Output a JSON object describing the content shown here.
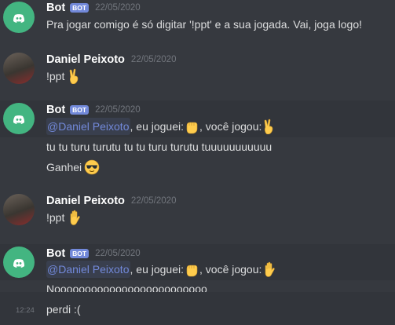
{
  "messages": {
    "m1": {
      "author": "Bot",
      "badge": "BOT",
      "timestamp": "22/05/2020",
      "text": "Pra jogar comigo é só digitar '!ppt' e a sua jogada. Vai, joga logo!"
    },
    "m2": {
      "author": "Daniel Peixoto",
      "timestamp": "22/05/2020",
      "text": "!ppt",
      "emoji": "victory-hand"
    },
    "m3": {
      "author": "Bot",
      "badge": "BOT",
      "timestamp": "22/05/2020",
      "mention": "@Daniel Peixoto",
      "text_a": ", eu joguei:",
      "text_b": ", você jogou:",
      "emoji_a": "raised-fist",
      "emoji_b": "victory-hand",
      "line2": "tu tu turu turutu tu tu turu turutu tuuuuuuuuuuu",
      "line3": "Ganhei",
      "emoji_c": "sunglasses-face"
    },
    "m4": {
      "author": "Daniel Peixoto",
      "timestamp": "22/05/2020",
      "text": "!ppt",
      "emoji": "raised-hand"
    },
    "m5": {
      "author": "Bot",
      "badge": "BOT",
      "timestamp": "22/05/2020",
      "mention": "@Daniel Peixoto",
      "text_a": ", eu joguei:",
      "text_b": ", você jogou:",
      "emoji_a": "raised-fist",
      "emoji_b": "raised-hand",
      "line2": "Nooooooooooooooooooooooooo",
      "line3": "perdi :(",
      "line3_time": "12:24"
    }
  },
  "colors": {
    "background": "#36393f",
    "hover": "#32353b",
    "bot_badge": "#7289da",
    "mention": "#7289da",
    "bot_avatar": "#43b581"
  }
}
